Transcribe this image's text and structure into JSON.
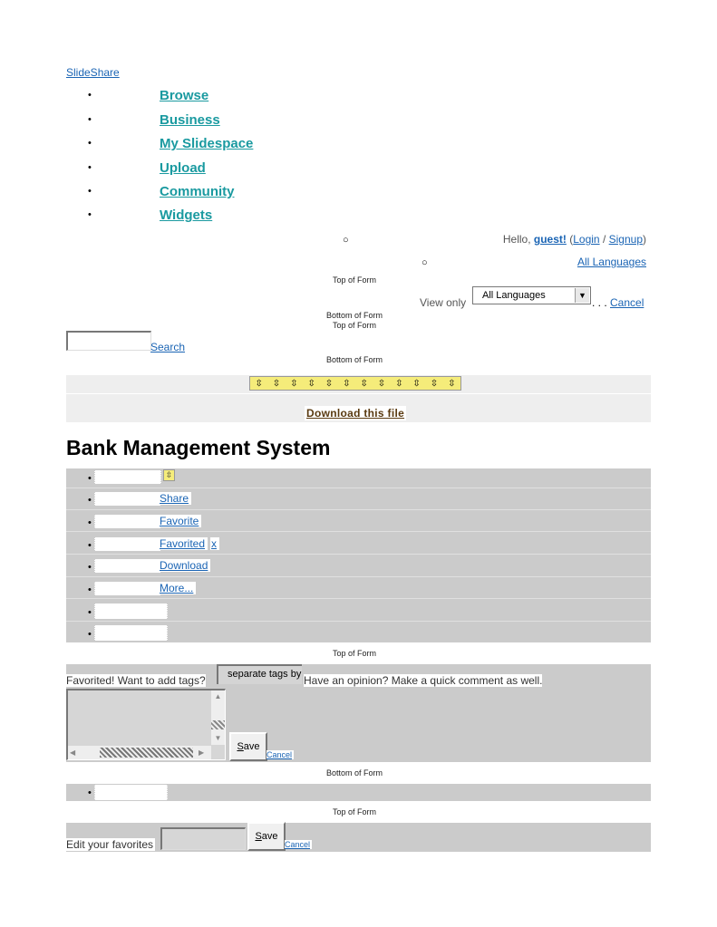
{
  "site_link": "SlideShare",
  "nav": {
    "items": [
      {
        "label": "Browse"
      },
      {
        "label": "Business"
      },
      {
        "label": "My Slidespace"
      },
      {
        "label": "Upload"
      },
      {
        "label": "Community"
      },
      {
        "label": "Widgets"
      }
    ]
  },
  "user_bar": {
    "hello_prefix": "Hello, ",
    "guest": "guest!",
    "open_paren": " (",
    "login": "Login",
    "slash": " / ",
    "signup": "Signup",
    "close_paren": ")",
    "all_languages_link": "All Languages"
  },
  "form_markers": {
    "top": "Top of Form",
    "bottom": "Bottom of Form"
  },
  "language_filter": {
    "view_only": "View only",
    "selected": "All Languages",
    "dots": ". . .",
    "cancel": "Cancel"
  },
  "search": {
    "value": "",
    "button": "Search"
  },
  "download_banner": {
    "label": "Download this file"
  },
  "doc_title": "Bank Management System",
  "actions": {
    "share": "Share",
    "favorite": "Favorite",
    "favorited": "Favorited",
    "remove_x": "x",
    "download": "Download",
    "more": "More..."
  },
  "tags_form": {
    "prompt": "Favorited! Want to add tags?",
    "tags_placeholder": "separate tags by",
    "opinion": "Have an opinion? Make a quick comment as well.",
    "save": "Save",
    "save_underline": "S",
    "save_rest": "ave",
    "cancel": "Cancel"
  },
  "edit_favorites": {
    "label": "Edit your favorites",
    "save_underline": "S",
    "save_rest": "ave",
    "cancel": "Cancel"
  },
  "colors": {
    "link": "#1a64b4",
    "nav": "#1a9aa0",
    "gray_bar": "#cbcbcb",
    "light_bar": "#eeeeee",
    "icon_yellow": "#f5ec7a",
    "download_text": "#5a3a10"
  }
}
